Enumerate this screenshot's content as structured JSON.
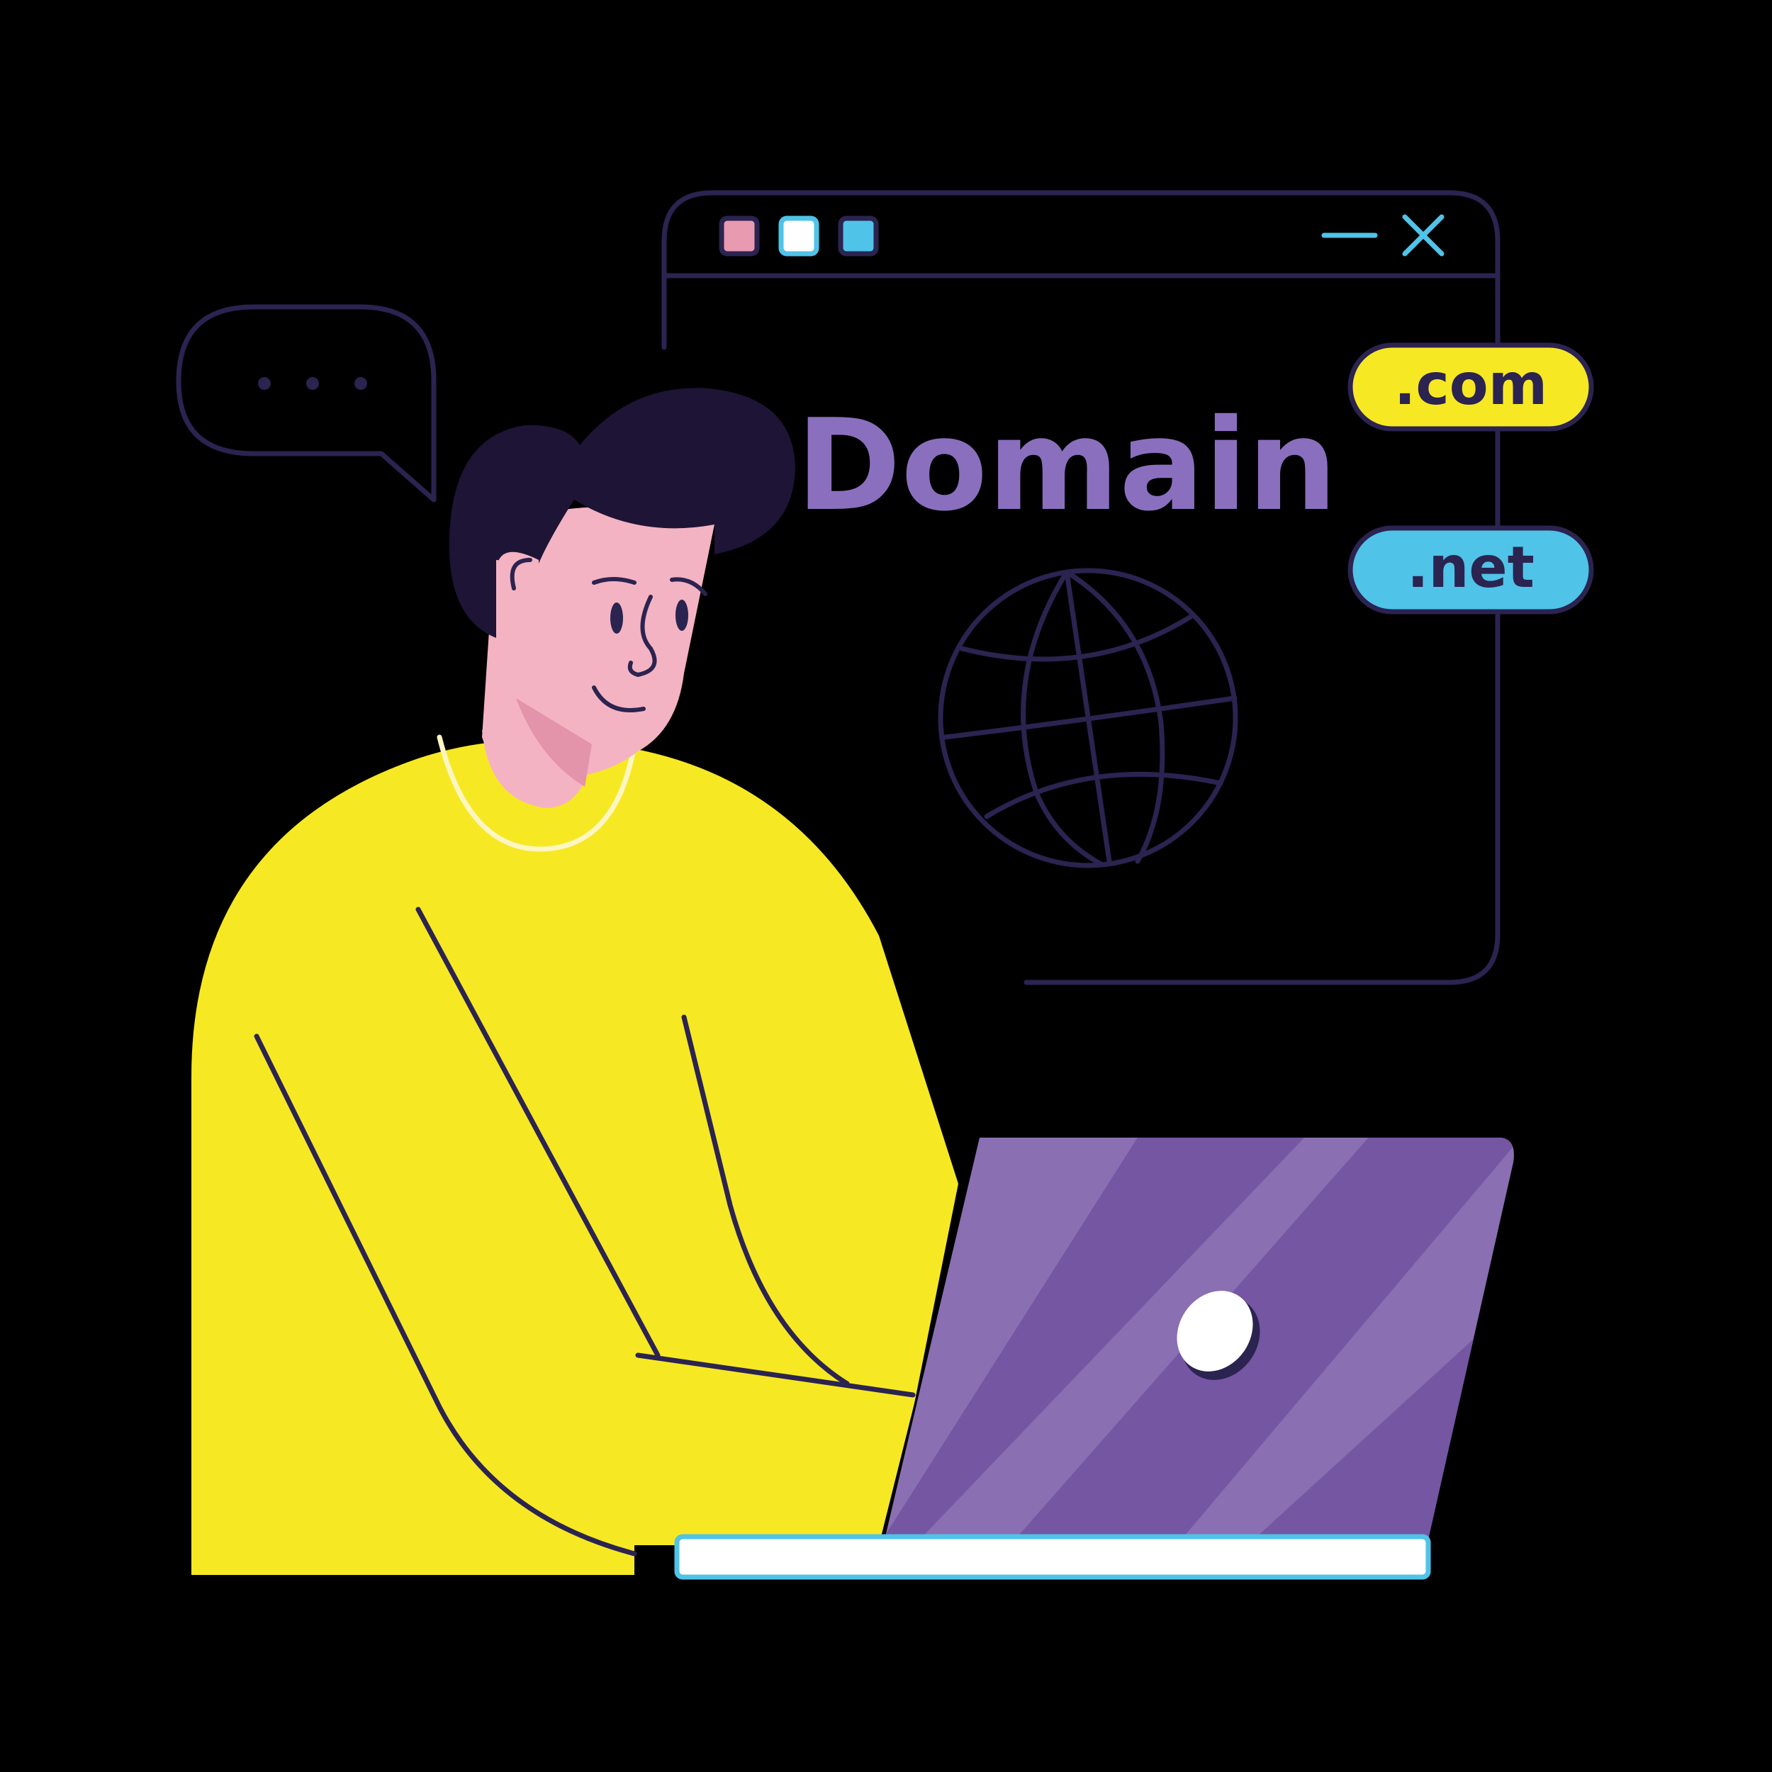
{
  "browser_window": {
    "title": "Domain",
    "buttons": {
      "red": "#E89AB0",
      "white": "#FFFFFF",
      "blue": "#4FC3E8"
    },
    "minimize_icon": "minimize-icon",
    "close_icon": "close-icon",
    "globe_icon": "globe-icon"
  },
  "domain_tags": [
    {
      "label": ".com",
      "color": "#F7E824"
    },
    {
      "label": ".net",
      "color": "#4FC3E8"
    }
  ],
  "speech_bubble": {
    "icon": "ellipsis-icon"
  },
  "laptop": {
    "logo_icon": "laptop-logo-icon"
  },
  "colors": {
    "background": "#000000",
    "outline": "#2B2350",
    "title": "#8A6FBF",
    "shirt": "#F7E824",
    "skin": "#F4B3C2",
    "skin_shade": "#E393AA",
    "hair": "#1E1436",
    "laptop_light": "#8A6FB2",
    "laptop_dark": "#7456A3",
    "accent_blue": "#4FC3E8"
  }
}
